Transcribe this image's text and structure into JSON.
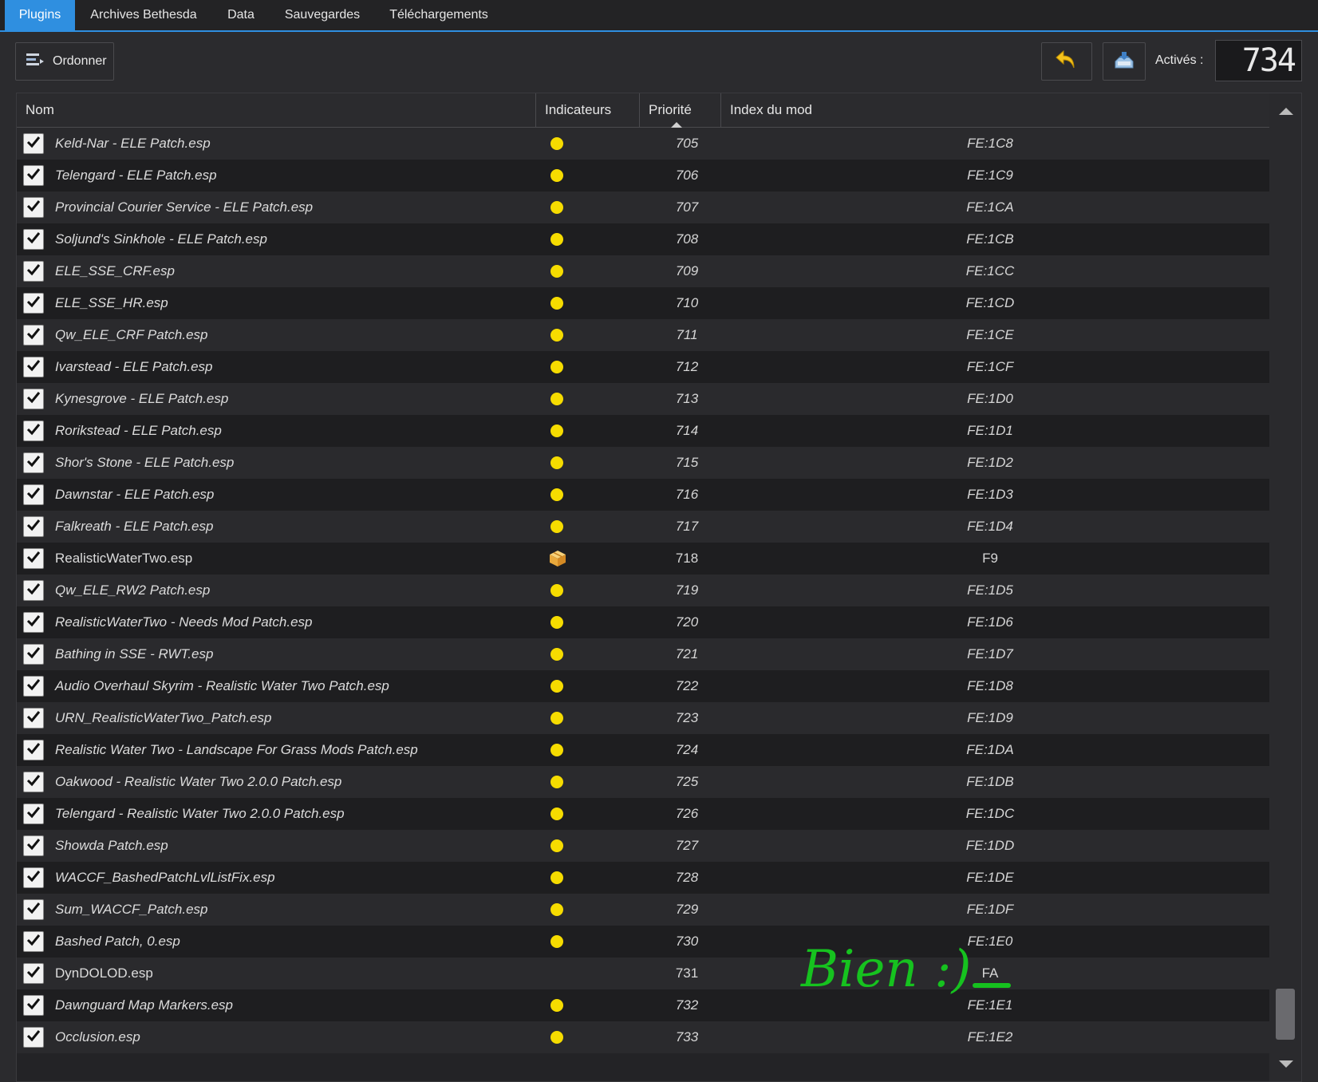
{
  "tabs": [
    {
      "label": "Plugins",
      "active": true
    },
    {
      "label": "Archives Bethesda"
    },
    {
      "label": "Data"
    },
    {
      "label": "Sauvegardes"
    },
    {
      "label": "Téléchargements"
    }
  ],
  "toolbar": {
    "order_label": "Ordonner",
    "active_label": "Activés :",
    "active_count": "734"
  },
  "columns": [
    "Nom",
    "Indicateurs",
    "Priorité",
    "Index du mod"
  ],
  "rows": [
    {
      "name": "Keld-Nar - ELE Patch.esp",
      "indicator": "dot",
      "priority": "705",
      "index": "FE:1C8"
    },
    {
      "name": "Telengard - ELE Patch.esp",
      "indicator": "dot",
      "priority": "706",
      "index": "FE:1C9"
    },
    {
      "name": "Provincial Courier Service - ELE Patch.esp",
      "indicator": "dot",
      "priority": "707",
      "index": "FE:1CA"
    },
    {
      "name": "Soljund's Sinkhole - ELE Patch.esp",
      "indicator": "dot",
      "priority": "708",
      "index": "FE:1CB"
    },
    {
      "name": "ELE_SSE_CRF.esp",
      "indicator": "dot",
      "priority": "709",
      "index": "FE:1CC"
    },
    {
      "name": "ELE_SSE_HR.esp",
      "indicator": "dot",
      "priority": "710",
      "index": "FE:1CD"
    },
    {
      "name": "Qw_ELE_CRF Patch.esp",
      "indicator": "dot",
      "priority": "711",
      "index": "FE:1CE"
    },
    {
      "name": "Ivarstead - ELE Patch.esp",
      "indicator": "dot",
      "priority": "712",
      "index": "FE:1CF"
    },
    {
      "name": "Kynesgrove - ELE Patch.esp",
      "indicator": "dot",
      "priority": "713",
      "index": "FE:1D0"
    },
    {
      "name": "Rorikstead - ELE Patch.esp",
      "indicator": "dot",
      "priority": "714",
      "index": "FE:1D1"
    },
    {
      "name": "Shor's Stone - ELE Patch.esp",
      "indicator": "dot",
      "priority": "715",
      "index": "FE:1D2"
    },
    {
      "name": "Dawnstar - ELE Patch.esp",
      "indicator": "dot",
      "priority": "716",
      "index": "FE:1D3"
    },
    {
      "name": "Falkreath - ELE Patch.esp",
      "indicator": "dot",
      "priority": "717",
      "index": "FE:1D4"
    },
    {
      "name": "RealisticWaterTwo.esp",
      "indicator": "package",
      "priority": "718",
      "index": "F9"
    },
    {
      "name": "Qw_ELE_RW2 Patch.esp",
      "indicator": "dot",
      "priority": "719",
      "index": "FE:1D5"
    },
    {
      "name": "RealisticWaterTwo - Needs Mod Patch.esp",
      "indicator": "dot",
      "priority": "720",
      "index": "FE:1D6"
    },
    {
      "name": "Bathing in SSE - RWT.esp",
      "indicator": "dot",
      "priority": "721",
      "index": "FE:1D7"
    },
    {
      "name": "Audio Overhaul Skyrim - Realistic Water Two Patch.esp",
      "indicator": "dot",
      "priority": "722",
      "index": "FE:1D8"
    },
    {
      "name": "URN_RealisticWaterTwo_Patch.esp",
      "indicator": "dot",
      "priority": "723",
      "index": "FE:1D9"
    },
    {
      "name": "Realistic Water Two - Landscape For Grass Mods Patch.esp",
      "indicator": "dot",
      "priority": "724",
      "index": "FE:1DA"
    },
    {
      "name": "Oakwood - Realistic Water Two 2.0.0 Patch.esp",
      "indicator": "dot",
      "priority": "725",
      "index": "FE:1DB"
    },
    {
      "name": "Telengard - Realistic Water Two 2.0.0 Patch.esp",
      "indicator": "dot",
      "priority": "726",
      "index": "FE:1DC"
    },
    {
      "name": "Showda Patch.esp",
      "indicator": "dot",
      "priority": "727",
      "index": "FE:1DD"
    },
    {
      "name": "WACCF_BashedPatchLvlListFix.esp",
      "indicator": "dot",
      "priority": "728",
      "index": "FE:1DE"
    },
    {
      "name": "Sum_WACCF_Patch.esp",
      "indicator": "dot",
      "priority": "729",
      "index": "FE:1DF"
    },
    {
      "name": "Bashed Patch, 0.esp",
      "indicator": "dot",
      "priority": "730",
      "index": "FE:1E0"
    },
    {
      "name": "DynDOLOD.esp",
      "indicator": "none",
      "priority": "731",
      "index": "FA"
    },
    {
      "name": "Dawnguard Map Markers.esp",
      "indicator": "dot",
      "priority": "732",
      "index": "FE:1E1"
    },
    {
      "name": "Occlusion.esp",
      "indicator": "dot",
      "priority": "733",
      "index": "FE:1E2"
    }
  ],
  "annotation": "Bien :)",
  "colors": {
    "accent": "#2f8fe0",
    "indicator_dot": "#f6dc00",
    "annotation": "#16c21f"
  },
  "icons": {
    "order": "sort-list-icon",
    "undo": "undo-arrow-icon",
    "save": "save-disk-icon",
    "checkbox": "checkmark-icon",
    "package": "package-box-icon"
  }
}
